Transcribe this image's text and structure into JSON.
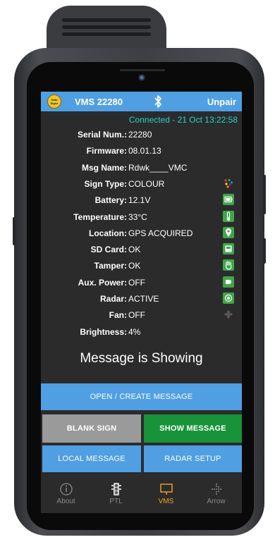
{
  "header": {
    "title": "VMS 22280",
    "logo_text": "Data Signs",
    "action": "Unpair"
  },
  "status": {
    "connection": "Connected - 21 Oct 13:22:58"
  },
  "details": [
    {
      "label": "Serial Num.:",
      "value": "22280",
      "icon": ""
    },
    {
      "label": "Firmware:",
      "value": "08.01.13",
      "icon": ""
    },
    {
      "label": "Msg Name:",
      "value": "Rdwk____VMC",
      "icon": ""
    },
    {
      "label": "Sign Type:",
      "value": "COLOUR",
      "icon": "colour-dots-icon"
    },
    {
      "label": "Battery:",
      "value": "12.1V",
      "icon": "battery-icon"
    },
    {
      "label": "Temperature:",
      "value": "33°C",
      "icon": "thermometer-icon"
    },
    {
      "label": "Location:",
      "value": "GPS ACQUIRED",
      "icon": "location-pin-icon"
    },
    {
      "label": "SD Card:",
      "value": "OK",
      "icon": "sd-card-icon"
    },
    {
      "label": "Tamper:",
      "value": "OK",
      "icon": "tamper-hand-icon"
    },
    {
      "label": "Aux. Power:",
      "value": "OFF",
      "icon": "aux-power-icon"
    },
    {
      "label": "Radar:",
      "value": "ACTIVE",
      "icon": "radar-icon"
    },
    {
      "label": "Fan:",
      "value": "OFF",
      "icon": "fan-icon"
    },
    {
      "label": "Brightness:",
      "value": "4%",
      "icon": ""
    }
  ],
  "message_status": "Message is Showing",
  "buttons": {
    "open_create": "OPEN / CREATE MESSAGE",
    "blank_sign": "BLANK SIGN",
    "show_message": "SHOW MESSAGE",
    "local_message": "LOCAL MESSAGE",
    "radar_setup": "RADAR SETUP"
  },
  "nav": [
    {
      "label": "About",
      "icon": "info-icon",
      "active": false
    },
    {
      "label": "PTL",
      "icon": "traffic-light-icon",
      "active": false
    },
    {
      "label": "VMS",
      "icon": "sign-board-icon",
      "active": true
    },
    {
      "label": "Arrow",
      "icon": "arrow-board-icon",
      "active": false
    }
  ],
  "colors": {
    "accent_blue": "#4f9fe2",
    "green": "#18933a",
    "grey": "#9a9a9a",
    "connected_text": "#22d6c7",
    "active_nav": "#f0a52a",
    "background": "#2b2b2c"
  }
}
